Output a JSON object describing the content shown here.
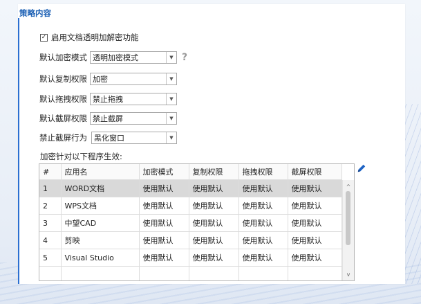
{
  "section": {
    "title": "策略内容"
  },
  "enable_checkbox": {
    "label": "启用文档透明加解密功能",
    "checked": true,
    "mark": "✓"
  },
  "form": [
    {
      "label": "默认加密模式",
      "value": "透明加密模式",
      "help": "?"
    },
    {
      "label": "默认复制权限",
      "value": "加密"
    },
    {
      "label": "默认拖拽权限",
      "value": "禁止拖拽"
    },
    {
      "label": "默认截屏权限",
      "value": "禁止截屏"
    },
    {
      "label": "禁止截屏行为",
      "value": "黑化窗口"
    }
  ],
  "dropdown_arrow": "▼",
  "table": {
    "caption": "加密针对以下程序生效:",
    "columns": [
      "#",
      "应用名",
      "加密模式",
      "复制权限",
      "拖拽权限",
      "截屏权限"
    ],
    "rows": [
      [
        "1",
        "WORD文档",
        "使用默认",
        "使用默认",
        "使用默认",
        "使用默认"
      ],
      [
        "2",
        "WPS文档",
        "使用默认",
        "使用默认",
        "使用默认",
        "使用默认"
      ],
      [
        "3",
        "中望CAD",
        "使用默认",
        "使用默认",
        "使用默认",
        "使用默认"
      ],
      [
        "4",
        "剪映",
        "使用默认",
        "使用默认",
        "使用默认",
        "使用默认"
      ],
      [
        "5",
        "Visual Studio",
        "使用默认",
        "使用默认",
        "使用默认",
        "使用默认"
      ],
      [
        "",
        "",
        "",
        "",
        "",
        ""
      ]
    ],
    "selected_row": 0
  },
  "scrollbar": {
    "up": "^",
    "down": "v"
  },
  "icons": {
    "edit": "pencil-icon",
    "help": "question-icon"
  },
  "colors": {
    "accent": "#1a5fb4",
    "edit_icon": "#1e63c4",
    "selected_row": "#d9d9d9"
  }
}
